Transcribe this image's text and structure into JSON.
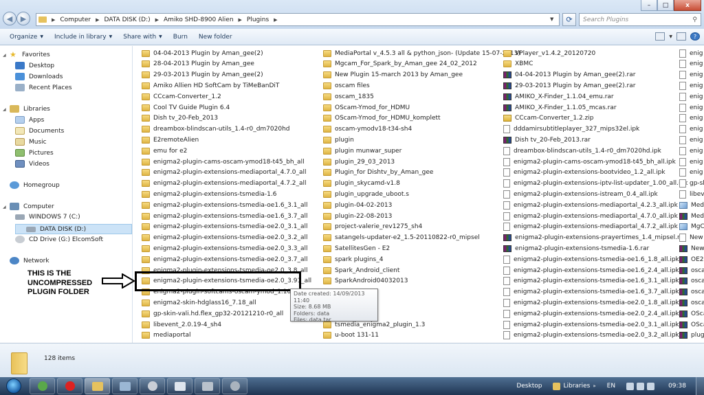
{
  "window": {
    "minimize": "–",
    "maximize": "□",
    "close": "x"
  },
  "address": {
    "crumbs": [
      "Computer",
      "DATA DISK (D:)",
      "Amiko SHD-8900 Alien",
      "Plugins"
    ],
    "search_placeholder": "Search Plugins"
  },
  "toolbar": {
    "organize": "Organize",
    "include_in_library": "Include in library",
    "share_with": "Share with",
    "burn": "Burn",
    "new_folder": "New folder"
  },
  "nav": {
    "favorites": "Favorites",
    "desktop": "Desktop",
    "downloads": "Downloads",
    "recent_places": "Recent Places",
    "libraries": "Libraries",
    "apps": "Apps",
    "documents": "Documents",
    "music": "Music",
    "pictures": "Pictures",
    "videos": "Videos",
    "homegroup": "Homegroup",
    "computer": "Computer",
    "windows7": "WINDOWS 7 (C:)",
    "data_disk": "DATA DISK (D:)",
    "cd_drive": "CD Drive (G:) ElcomSoft",
    "network": "Network"
  },
  "files": {
    "col1": [
      "04-04-2013 Plugin by Aman_gee(2)",
      "28-04-2013 Plugin by Aman_gee",
      "29-03-2013 Plugin by Aman_gee(2)",
      "Amiko Allien HD SoftCam by TiMeBanDiT",
      "CCcam-Converter_1.2",
      "Cool TV Guide Plugin 6.4",
      "Dish tv_20-Feb_2013",
      "dreambox-blindscan-utils_1.4-r0_dm7020hd",
      "E2remoteAlien",
      "emu for e2",
      "enigma2-plugin-cams-oscam-ymod18-t45_bh_all",
      "enigma2-plugin-extensions-mediaportal_4.7.0_all",
      "enigma2-plugin-extensions-mediaportal_4.7.2_all",
      "enigma2-plugin-extensions-tsmedia-1.6",
      "enigma2-plugin-extensions-tsmedia-oe1.6_3.1_all",
      "enigma2-plugin-extensions-tsmedia-oe1.6_3.7_all",
      "enigma2-plugin-extensions-tsmedia-oe2.0_3.1_all",
      "enigma2-plugin-extensions-tsmedia-oe2.0_3.2_all",
      "enigma2-plugin-extensions-tsmedia-oe2.0_3.3_all",
      "enigma2-plugin-extensions-tsmedia-oe2.0_3.7_all",
      "enigma2-plugin-extensions-tsmedia-oe2.0_3.8_all",
      "enigma2-plugin-extensions-tsmedia-oe2.0_3.91_all",
      "enigma2-plugin-softcams-oscam-ymod_1.10-r0_mips32el",
      "enigma2-skin-hdglass16_7.18_all",
      "gp-skin-vali.hd.flex_gp32-20121210-r0_all",
      "libevent_2.0.19-4_sh4",
      "mediaportal"
    ],
    "col2": [
      "MediaPortal v_4.5.3 all  & python_json- (Update 15-07-2013)",
      "Mgcam_For_Spark_by_Aman_gee 24_02_2012",
      "New Plugin 15-march 2013 by Aman_gee",
      "oscam files",
      "oscam_1835",
      "OScam-Ymod_for_HDMU",
      "OScam-Ymod_for_HDMU_komplett",
      "oscam-ymodv18-t34-sh4",
      "plugin",
      "plugin munwar_super",
      "plugin_29_03_2013",
      "Plugin_for Dishtv_by_Aman_gee",
      "plugin_skycamd-v1.8",
      "plugin_upgrade_uboot.s",
      "plugin-04-02-2013",
      "plugin-22-08-2013",
      "project-valerie_rev1275_sh4",
      "satangels-updater-e2_1.5-20110822-r0_mipsel",
      "SatellitesGen - E2",
      "spark plugins_4",
      "Spark_Android_client",
      "SparkAndroid04032013",
      "",
      "",
      "",
      "tsmedia_enigma2_plugin_1.3",
      "u-boot 131-11"
    ],
    "col3": [
      "VPlayer_v1.4.2_20120720",
      "XBMC",
      "04-04-2013 Plugin by Aman_gee(2).rar",
      "29-03-2013 Plugin by Aman_gee(2).rar",
      "AMIKO_X-Finder_1.1.04_emu.rar",
      "AMIKO_X-Finder_1.1.05_mcas.rar",
      "CCcam-Converter_1.2.zip",
      "dddamirsubtitleplayer_327_mips32el.ipk",
      "Dish tv_20-Feb_2013.rar",
      "dreambox-blindscan-utils_1.4-r0_dm7020hd.ipk",
      "enigma2-plugin-cams-oscam-ymod18-t45_bh_all.ipk",
      "enigma2-plugin-extensions-bootvideo_1.2_all.ipk",
      "enigma2-plugin-extensions-iptv-list-updater_1.00_all.ipk",
      "enigma2-plugin-extensions-istream_0.4_all.ipk",
      "enigma2-plugin-extensions-mediaportal_4.2.3_all.ipk",
      "enigma2-plugin-extensions-mediaportal_4.7.0_all.ipk",
      "enigma2-plugin-extensions-mediaportal_4.7.2_all.ipk",
      "enigma2-plugin-extensions-prayertimes_1.4_mipsel.rar",
      "enigma2-plugin-extensions-tsmedia-1.6.rar",
      "enigma2-plugin-extensions-tsmedia-oe1.6_1.8_all.ipk",
      "enigma2-plugin-extensions-tsmedia-oe1.6_2.4_all.ipk",
      "enigma2-plugin-extensions-tsmedia-oe1.6_3.1_all.ipk",
      "enigma2-plugin-extensions-tsmedia-oe1.6_3.7_all.ipk",
      "enigma2-plugin-extensions-tsmedia-oe2.0_1.8_all.ipk",
      "enigma2-plugin-extensions-tsmedia-oe2.0_2.4_all.ipk",
      "enigma2-plugin-extensions-tsmedia-oe2.0_3.1_all.ipk",
      "enigma2-plugin-extensions-tsmedia-oe2.0_3.2_all.ipk"
    ],
    "col3_icons": [
      "folder",
      "folder",
      "rar",
      "rar",
      "rar",
      "rar",
      "zip",
      "file",
      "rar",
      "file",
      "file",
      "file",
      "file",
      "file",
      "file",
      "file",
      "file",
      "rar",
      "rar",
      "file",
      "file",
      "file",
      "file",
      "file",
      "file",
      "file",
      "file"
    ],
    "col4": [
      "enig",
      "enig",
      "enig",
      "enig",
      "enig",
      "enig",
      "enig",
      "enig",
      "enig",
      "enig",
      "enig",
      "enig",
      "gp-sk",
      "libeve",
      "Media",
      "Media",
      "MgCa",
      "New P",
      "New P",
      "OE20.",
      "oscam",
      "oscam",
      "oscam",
      "oscam",
      "OScam",
      "OScar",
      "plugi"
    ],
    "col4_icons": [
      "file",
      "file",
      "file",
      "file",
      "file",
      "file",
      "file",
      "file",
      "file",
      "file",
      "file",
      "file",
      "file",
      "file",
      "img",
      "rar",
      "img",
      "file",
      "rar",
      "rar",
      "rar",
      "rar",
      "rar",
      "rar",
      "rar",
      "rar",
      "rar"
    ]
  },
  "tooltip": {
    "date_created": "Date created: 14/09/2013 11:40",
    "size": "Size: 8.68 MB",
    "folders": "Folders: data",
    "files": "Files: data.tar"
  },
  "annotation": {
    "line1": "THIS IS THE",
    "line2": "UNCOMPRESSED",
    "line3": "PLUGIN FOLDER"
  },
  "status": {
    "item_count": "128 items"
  },
  "taskbar": {
    "desktop": "Desktop",
    "libraries": "Libraries",
    "language": "EN",
    "time": "09:38"
  }
}
